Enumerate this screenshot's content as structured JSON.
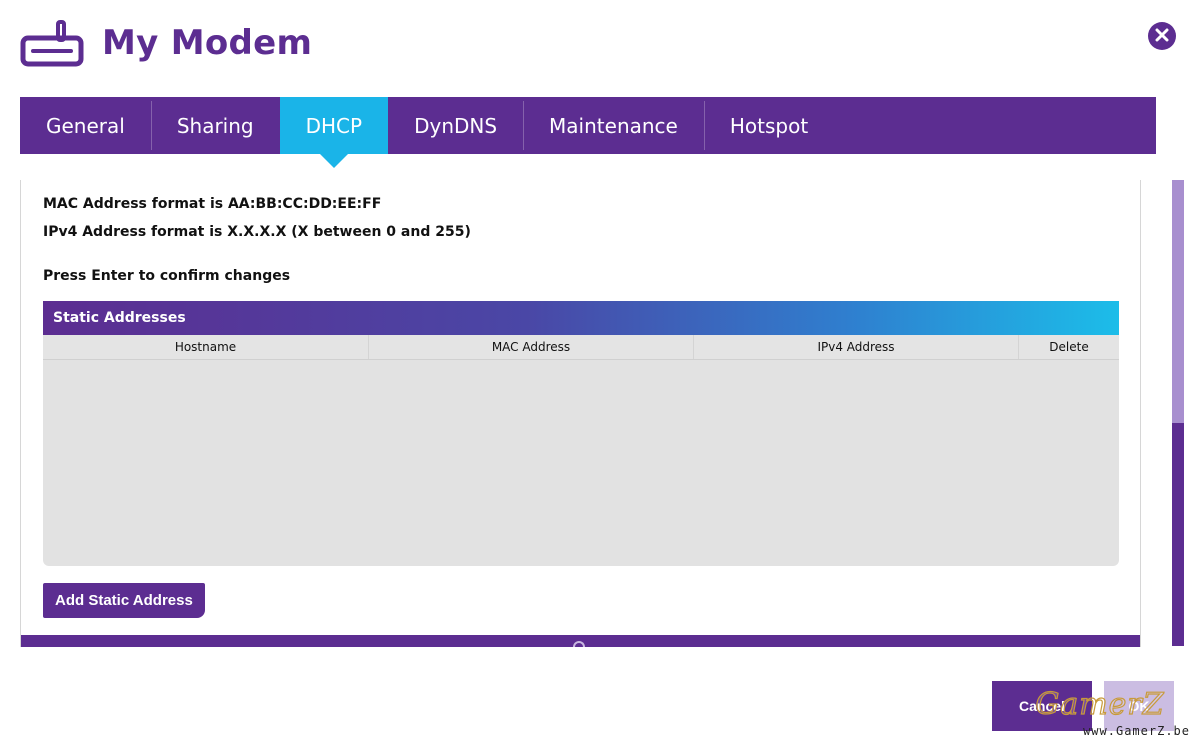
{
  "page": {
    "title": "My Modem"
  },
  "icons": {
    "modem": "modem-icon",
    "close": "close-icon",
    "handle": "chevron-up-icon"
  },
  "colors": {
    "brand_purple": "#5c2d91",
    "active_tab": "#1ab4e8",
    "scroll_track": "#a88fcf",
    "ok_disabled": "#cbbde2",
    "table_body": "#e2e2e2"
  },
  "tabs": [
    {
      "label": "General",
      "active": false
    },
    {
      "label": "Sharing",
      "active": false
    },
    {
      "label": "DHCP",
      "active": true
    },
    {
      "label": "DynDNS",
      "active": false
    },
    {
      "label": "Maintenance",
      "active": false
    },
    {
      "label": "Hotspot",
      "active": false
    }
  ],
  "info": {
    "mac_format": "MAC Address format is AA:BB:CC:DD:EE:FF",
    "ipv4_format": "IPv4 Address format is X.X.X.X (X between 0 and 255)",
    "enter_hint": "Press Enter to confirm changes"
  },
  "static_table": {
    "title": "Static Addresses",
    "columns": [
      "Hostname",
      "MAC Address",
      "IPv4 Address",
      "Delete"
    ],
    "rows": []
  },
  "buttons": {
    "add_static": "Add Static Address",
    "cancel": "Cancel",
    "ok": "OK"
  },
  "watermark": {
    "brand": "GamerZ",
    "url": "www.GamerZ.be"
  }
}
